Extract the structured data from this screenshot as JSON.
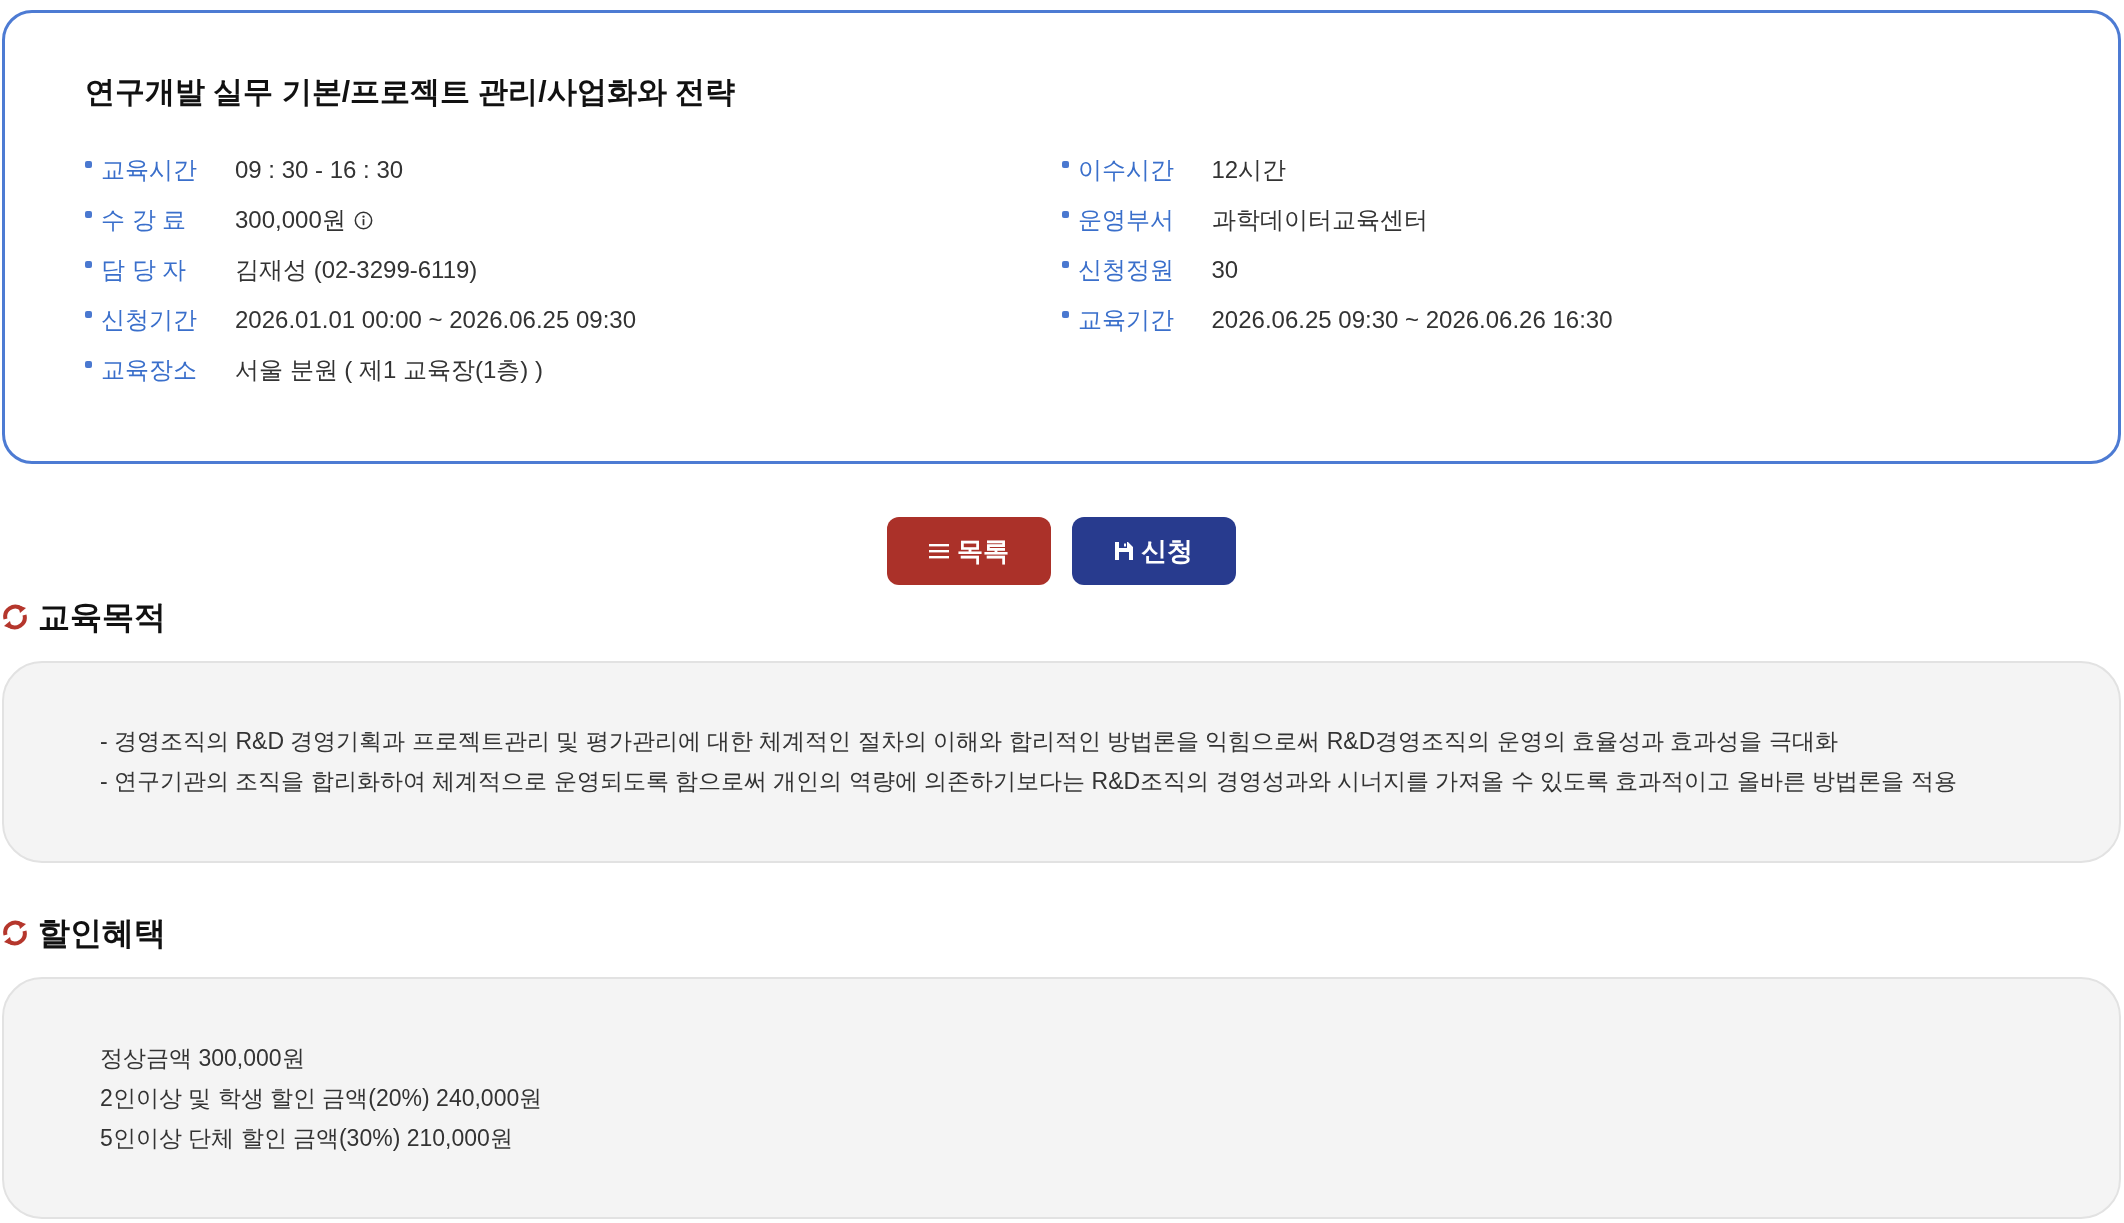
{
  "course": {
    "title": "연구개발 실무 기본/프로젝트 관리/사업화와 전략",
    "details_left": [
      {
        "label": "교육시간",
        "value": "09 : 30 - 16 : 30",
        "info_icon": false
      },
      {
        "label": "수 강 료",
        "value": "300,000원",
        "info_icon": true
      },
      {
        "label": "담 당 자",
        "value": "김재성 (02-3299-6119)",
        "info_icon": false
      },
      {
        "label": "신청기간",
        "value": "2026.01.01 00:00 ~ 2026.06.25 09:30",
        "info_icon": false
      },
      {
        "label": "교육장소",
        "value": "서울 분원 ( 제1 교육장(1층) )",
        "info_icon": false
      }
    ],
    "details_right": [
      {
        "label": "이수시간",
        "value": "12시간",
        "info_icon": false
      },
      {
        "label": "운영부서",
        "value": "과학데이터교육센터",
        "info_icon": false
      },
      {
        "label": "신청정원",
        "value": "30",
        "info_icon": false
      },
      {
        "label": "교육기간",
        "value": "2026.06.25 09:30 ~ 2026.06.26 16:30",
        "info_icon": false
      }
    ]
  },
  "buttons": [
    {
      "kind": "list",
      "label": "목록"
    },
    {
      "kind": "apply",
      "label": "신청"
    }
  ],
  "sections": [
    {
      "heading": "교육목적",
      "lines": [
        "- 경영조직의 R&D 경영기획과 프로젝트관리 및 평가관리에 대한 체계적인 절차의 이해와 합리적인 방법론을 익힘으로써 R&D경영조직의 운영의 효율성과 효과성을 극대화",
        "- 연구기관의 조직을 합리화하여 체계적으로 운영되도록 함으로써 개인의 역량에 의존하기보다는 R&D조직의 경영성과와 시너지를 가져올 수 있도록 효과적이고 올바른 방법론을 적용"
      ]
    },
    {
      "heading": "할인혜택",
      "lines": [
        "정상금액 300,000원",
        "2인이상 및 학생 할인 금액(20%) 240,000원",
        "5인이상 단체 할인 금액(30%) 210,000원"
      ]
    }
  ]
}
